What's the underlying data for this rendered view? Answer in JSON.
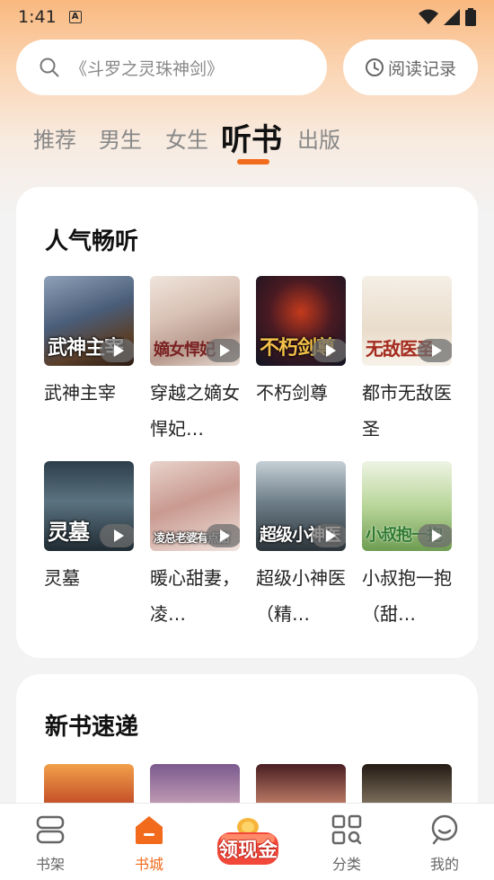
{
  "status_bar": {
    "time": "1:41",
    "notif_icon": "A"
  },
  "search": {
    "placeholder": "《斗罗之灵珠神剑》",
    "history_label": "阅读记录"
  },
  "tabs": [
    {
      "label": "推荐"
    },
    {
      "label": "男生"
    },
    {
      "label": "女生"
    },
    {
      "label": "听书",
      "active": true
    },
    {
      "label": "出版"
    }
  ],
  "popular": {
    "title": "人气畅听",
    "books": [
      {
        "title": "武神主宰",
        "cover_text": "武神主宰"
      },
      {
        "title": "穿越之嫡女悍妃…",
        "cover_text": "嫡女悍妃"
      },
      {
        "title": "不朽剑尊",
        "cover_text": "不朽剑尊"
      },
      {
        "title": "都市无敌医圣",
        "cover_text": "无敌医圣"
      },
      {
        "title": "灵墓",
        "cover_text": "灵墓"
      },
      {
        "title": "暖心甜妻，凌…",
        "cover_text": "凌总老婆有点甜"
      },
      {
        "title": "超级小神医（精…",
        "cover_text": "超级小神医"
      },
      {
        "title": "小叔抱一抱（甜…",
        "cover_text": "小叔抱一抱"
      }
    ]
  },
  "new_books": {
    "title": "新书速递"
  },
  "bottom_nav": {
    "shelf": "书架",
    "store": "书城",
    "cash": "领现金",
    "category": "分类",
    "mine": "我的"
  },
  "colors": {
    "accent": "#f26b1d"
  }
}
